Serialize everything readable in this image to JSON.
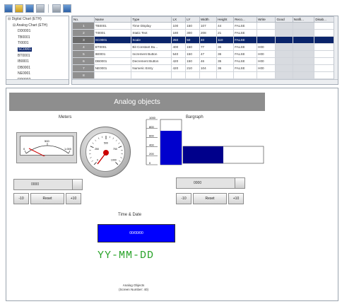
{
  "window": {
    "width": 484,
    "height": 430
  },
  "colors": {
    "selection": "#0a246a",
    "title_bar": "#8e8e8e",
    "bar_fill": "#00008b",
    "bar_fill_bright": "#0000cd",
    "date_box": "#0000ff",
    "date_text": "#29a329",
    "needle": "#cc0000"
  },
  "toolbar": {
    "buttons": [
      "new-icon",
      "save-icon",
      "edit-icon",
      "copy-icon",
      "print-icon",
      "help-icon"
    ]
  },
  "tree": {
    "items": [
      {
        "label": "Digital Chart (ETH)",
        "indent": 0
      },
      {
        "label": "Analog Chart (ETH)",
        "indent": 1
      },
      {
        "label": "DD0001",
        "indent": 2
      },
      {
        "label": "TB0001",
        "indent": 2
      },
      {
        "label": "TI0001",
        "indent": 2
      },
      {
        "label": "SC0001",
        "indent": 2,
        "selected": true
      },
      {
        "label": "BT0001",
        "indent": 2
      },
      {
        "label": "IB0001",
        "indent": 2
      },
      {
        "label": "DB0001",
        "indent": 2
      },
      {
        "label": "NE0001",
        "indent": 2
      },
      {
        "label": "DD0002",
        "indent": 2
      }
    ]
  },
  "grid": {
    "headers": [
      "No.",
      "Name",
      "Type",
      "LX",
      "LY",
      "Width",
      "Height",
      "Reco...",
      "Write",
      "Good",
      "Notifi...",
      "Disab..."
    ],
    "rows": [
      {
        "cells": [
          "1",
          "TB0001",
          "Time Display",
          "100",
          "150",
          "107",
          "44",
          "FALSE",
          "",
          "",
          "",
          ""
        ]
      },
      {
        "cells": [
          "2",
          "TI0001",
          "Static Text",
          "180",
          "300",
          "208",
          "21",
          "FALSE",
          "",
          "",
          "",
          ""
        ]
      },
      {
        "cells": [
          "3",
          "SC0001",
          "Scale",
          "250",
          "50",
          "40",
          "110",
          "FALSE",
          "",
          "",
          "",
          ""
        ],
        "selected": true
      },
      {
        "cells": [
          "4",
          "BT0001",
          "Bit Constant Bu...",
          "400",
          "150",
          "77",
          "36",
          "FALSE",
          "H00",
          "",
          "",
          ""
        ]
      },
      {
        "cells": [
          "5",
          "IB0001",
          "Increment Button",
          "540",
          "150",
          "47",
          "36",
          "FALSE",
          "H00",
          "",
          "",
          ""
        ]
      },
      {
        "cells": [
          "6",
          "DB0001",
          "Decrement Button",
          "420",
          "150",
          "46",
          "35",
          "FALSE",
          "H00",
          "",
          "",
          ""
        ]
      },
      {
        "cells": [
          "7",
          "NE0001",
          "Numeric Entry",
          "420",
          "210",
          "104",
          "36",
          "FALSE",
          "H00",
          "",
          "",
          ""
        ]
      },
      {
        "cells": [
          "8",
          "",
          "",
          "",
          "",
          "",
          "",
          "",
          "",
          "",
          "",
          ""
        ]
      }
    ]
  },
  "screen": {
    "title": "Analog objects",
    "meters_label": "Meters",
    "bargraph_label": "Bargraph",
    "time_date_label": "Time & Date",
    "meter_scale": [
      "0",
      "500",
      "1,000"
    ],
    "gauge_scale": [
      "0",
      "250",
      "500",
      "750",
      "1000"
    ],
    "bar_scale": [
      "1000",
      "800",
      "600",
      "400",
      "200",
      "0"
    ],
    "bar_vertical_level": 0.75,
    "bar_horizontal_level": 0.5,
    "left_control": {
      "value": "0000",
      "dec_label": "-10",
      "reset_label": "Reset",
      "inc_label": "+10"
    },
    "right_control": {
      "value": "0000",
      "dec_label": "-10",
      "reset_label": "Reset",
      "inc_label": "+10"
    },
    "date_box_value": "00/00/00",
    "date_format": "YY-MM-DD",
    "footer_line1": "Analog Objects",
    "footer_line2": "(Screen Number: 40)"
  }
}
